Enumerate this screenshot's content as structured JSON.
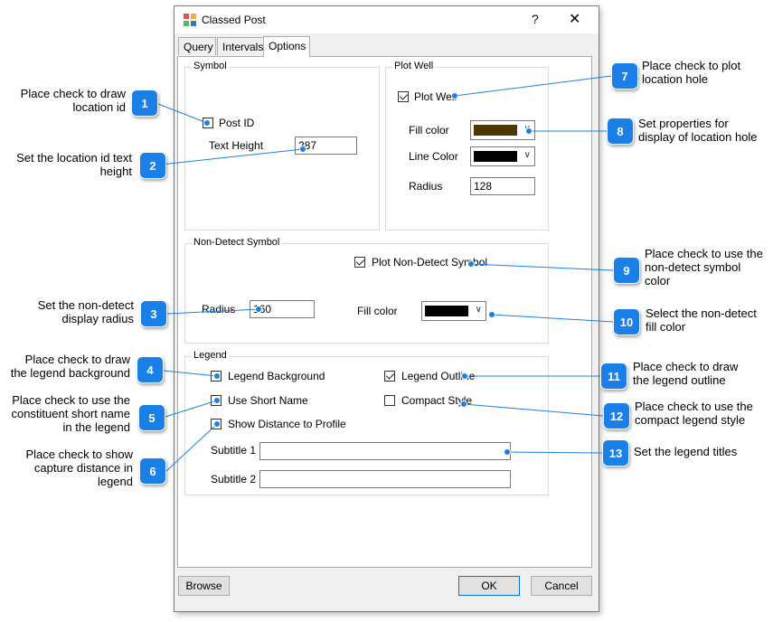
{
  "dialog": {
    "title": "Classed Post",
    "help_glyph": "?",
    "close_glyph": "✕",
    "tabs": [
      {
        "label": "Query",
        "active": false
      },
      {
        "label": "Intervals",
        "active": false
      },
      {
        "label": "Options",
        "active": true
      }
    ],
    "symbol": {
      "group_title": "Symbol",
      "post_id_label": "Post ID",
      "post_id_checked": false,
      "text_height_label": "Text Height",
      "text_height_value": "287"
    },
    "plot_well": {
      "group_title": "Plot Well",
      "plot_well_label": "Plot Well",
      "plot_well_checked": true,
      "fill_color_label": "Fill color",
      "fill_color": "#4a3800",
      "line_color_label": "Line Color",
      "line_color": "#000000",
      "radius_label": "Radius",
      "radius_value": "128"
    },
    "non_detect": {
      "group_title": "Non-Detect Symbol",
      "plot_label": "Plot Non-Detect Symbol",
      "plot_checked": true,
      "radius_label": "Radius",
      "radius_value": "160",
      "fill_color_label": "Fill color",
      "fill_color": "#000000"
    },
    "legend": {
      "group_title": "Legend",
      "background_label": "Legend Background",
      "background_checked": false,
      "outline_label": "Legend Outline",
      "outline_checked": true,
      "short_name_label": "Use Short Name",
      "short_name_checked": false,
      "compact_label": "Compact Style",
      "compact_checked": false,
      "distance_label": "Show Distance to Profile",
      "distance_checked": false,
      "subtitle1_label": "Subtitle 1",
      "subtitle1_value": "",
      "subtitle2_label": "Subtitle 2",
      "subtitle2_value": ""
    },
    "buttons": {
      "browse": "Browse",
      "ok": "OK",
      "cancel": "Cancel"
    }
  },
  "annotations": [
    {
      "n": "1",
      "text": "Place check to draw\nlocation id"
    },
    {
      "n": "2",
      "text": "Set the location id text\nheight"
    },
    {
      "n": "3",
      "text": "Set the non-detect\ndisplay radius"
    },
    {
      "n": "4",
      "text": "Place check to draw\nthe legend background"
    },
    {
      "n": "5",
      "text": "Place check to use the\nconstituent short name\nin the legend"
    },
    {
      "n": "6",
      "text": "Place check to show\ncapture distance in\nlegend"
    },
    {
      "n": "7",
      "text": "Place check to plot\nlocation hole"
    },
    {
      "n": "8",
      "text": "Set properties for\ndisplay of location hole"
    },
    {
      "n": "9",
      "text": "Place check to use the\nnon-detect symbol\ncolor"
    },
    {
      "n": "10",
      "text": "Select the non-detect\nfill color"
    },
    {
      "n": "11",
      "text": "Place check to draw\nthe legend outline"
    },
    {
      "n": "12",
      "text": "Place check to use the\ncompact legend style"
    },
    {
      "n": "13",
      "text": "Set the legend titles"
    }
  ],
  "colors": {
    "badge": "#1a80e8",
    "leader": "#1a80e8"
  }
}
